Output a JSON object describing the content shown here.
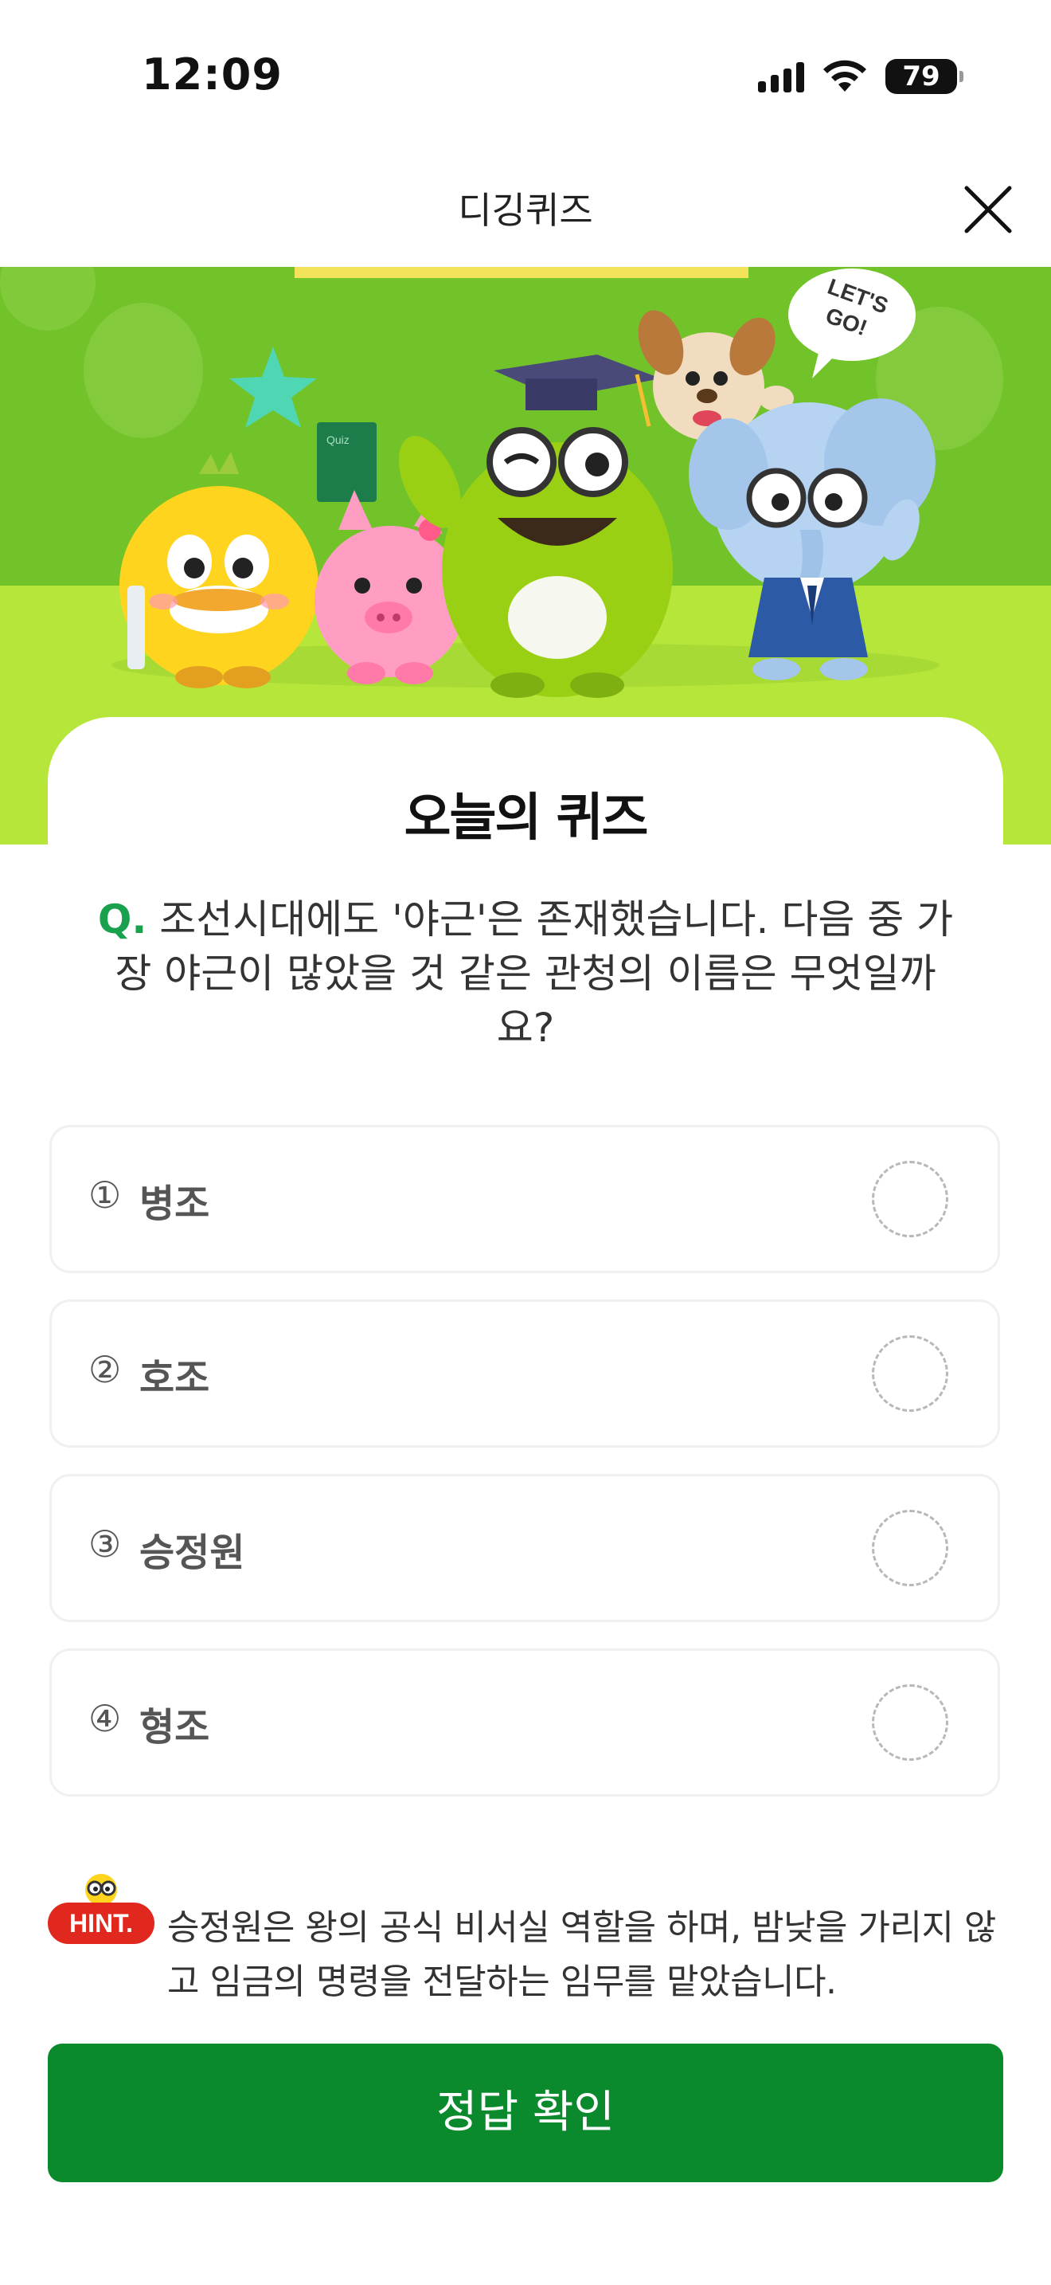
{
  "status_bar": {
    "time": "12:09",
    "battery": "79",
    "icons": [
      "signal-icon",
      "wifi-icon",
      "battery-icon"
    ]
  },
  "header": {
    "title": "디깅퀴즈",
    "close_icon": "close-icon"
  },
  "banner": {
    "speech_bubble": "LET'S GO!",
    "book_text": "Quiz"
  },
  "quiz": {
    "heading": "오늘의 퀴즈",
    "question_marker": "Q.",
    "question_text": "조선시대에도 '야근'은 존재했습니다. 다음 중 가장 야근이 많았을 것 같은 관청의 이름은 무엇일까요?",
    "options": [
      {
        "number": "①",
        "label": "병조"
      },
      {
        "number": "②",
        "label": "호조"
      },
      {
        "number": "③",
        "label": "승정원"
      },
      {
        "number": "④",
        "label": "형조"
      }
    ]
  },
  "hint": {
    "badge": "HINT.",
    "text": "승정원은 왕의 공식 비서실 역할을 하며, 밤낮을 가리지 않고 임금의 명령을 전달하는 임무를 맡았습니다."
  },
  "submit": {
    "label": "정답 확인"
  },
  "colors": {
    "accent_green": "#0a8a2c",
    "banner_green": "#7ccb2c",
    "question_marker": "#1aa14e",
    "hint_red": "#e0281e"
  }
}
